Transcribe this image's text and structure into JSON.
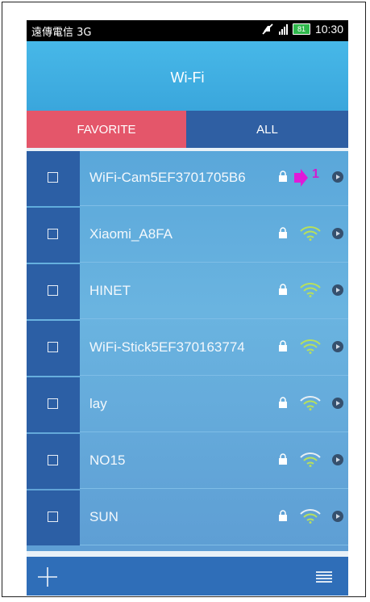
{
  "status_bar": {
    "carrier": "遠傳電信 3G",
    "battery": "81",
    "time": "10:30"
  },
  "header": {
    "title": "Wi-Fi"
  },
  "tabs": [
    {
      "label": "FAVORITE",
      "active": true
    },
    {
      "label": "ALL",
      "active": false
    }
  ],
  "networks": [
    {
      "ssid": "WiFi-Cam5EF3701705B6",
      "locked": true
    },
    {
      "ssid": "Xiaomi_A8FA",
      "locked": true
    },
    {
      "ssid": "HINET",
      "locked": true
    },
    {
      "ssid": "WiFi-Stick5EF370163774",
      "locked": true
    },
    {
      "ssid": "lay",
      "locked": true
    },
    {
      "ssid": "NO15",
      "locked": true
    },
    {
      "ssid": "SUN",
      "locked": true
    }
  ],
  "annotation": {
    "label": "1",
    "color": "#d21ad0"
  },
  "colors": {
    "favorite_tab": "#e4566a",
    "all_tab": "#2f5fa3",
    "header": "#47b8e8",
    "wifi_signal": "#b8e05a"
  },
  "icons": {
    "add": "plus-icon",
    "menu": "list-menu-icon",
    "lock": "lock-icon",
    "signal": "wifi-icon",
    "detail": "chevron-right-icon"
  }
}
